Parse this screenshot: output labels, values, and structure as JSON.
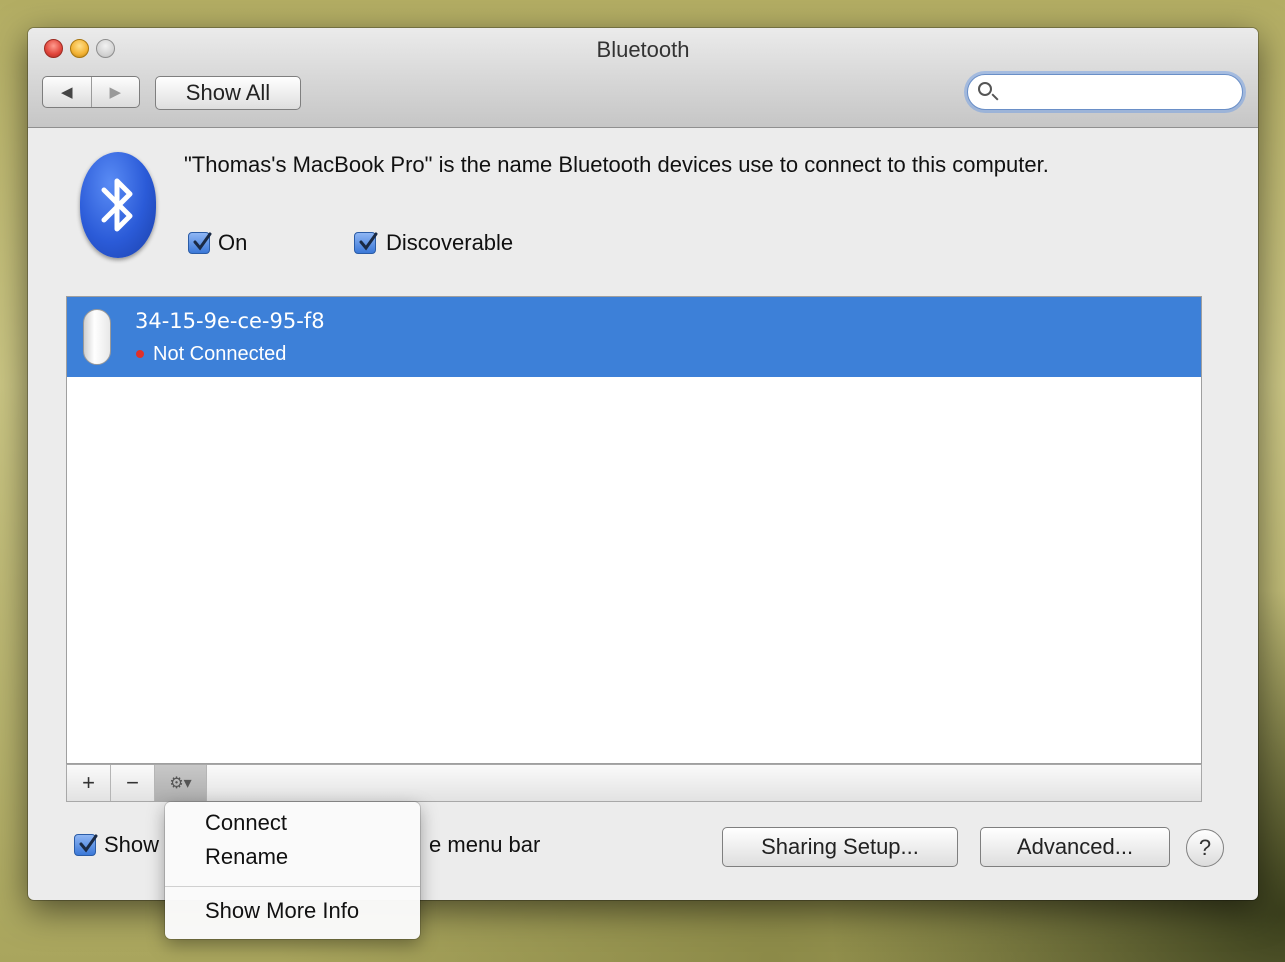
{
  "window": {
    "title": "Bluetooth"
  },
  "toolbar": {
    "back_icon": "◀",
    "forward_icon": "▶",
    "show_all_label": "Show All",
    "search_placeholder": ""
  },
  "header": {
    "description": "\"Thomas's MacBook Pro\" is the name Bluetooth devices use to connect to this computer.",
    "on_label": "On",
    "on_checked": true,
    "discoverable_label": "Discoverable",
    "discoverable_checked": true
  },
  "devices": [
    {
      "name": "34-15-9e-ce-95-f8",
      "status": "Not Connected",
      "status_color": "#e0302a",
      "icon": "mouse-icon",
      "selected": true
    }
  ],
  "list_toolbar": {
    "add_label": "+",
    "remove_label": "−",
    "gear_label": "⚙▾"
  },
  "footer": {
    "show_menu_bar_label_visible_start": "Show",
    "show_menu_bar_label_visible_end": "e menu bar",
    "show_menu_bar_checked": true,
    "sharing_setup_label": "Sharing Setup...",
    "advanced_label": "Advanced...",
    "help_label": "?"
  },
  "context_menu": {
    "items": [
      "Connect",
      "Rename",
      "Show More Info"
    ]
  },
  "colors": {
    "selection": "#3d80d8",
    "accent": "#3b78d8",
    "bluetooth_logo": "#2b5bd8"
  }
}
